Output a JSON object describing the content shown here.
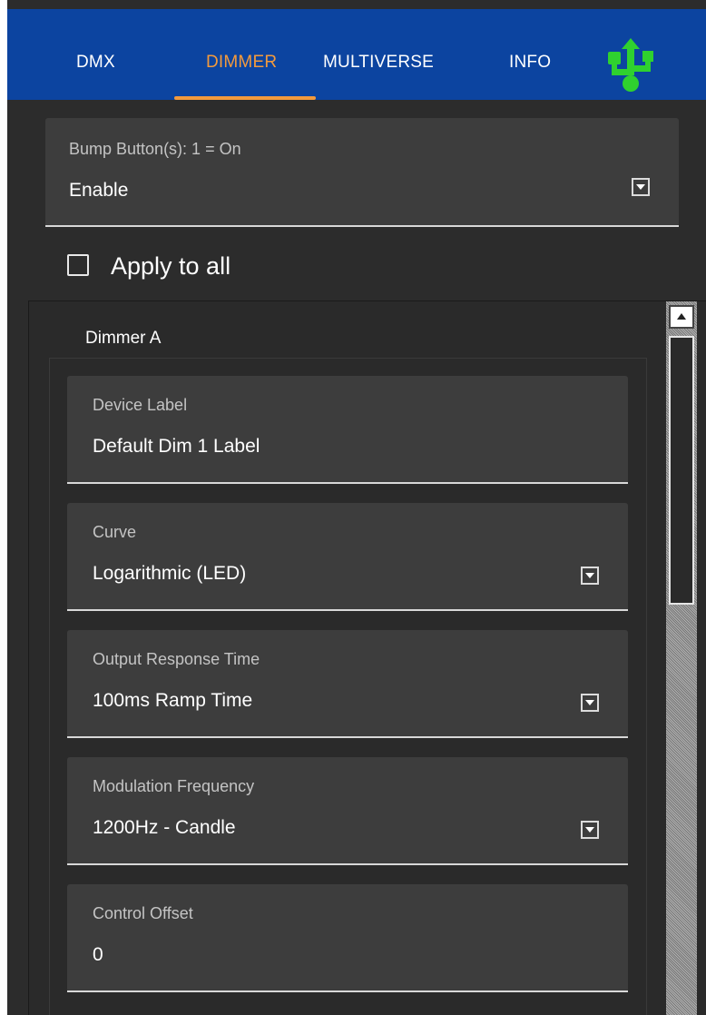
{
  "nav": {
    "tabs": [
      {
        "label": "DMX",
        "active": false
      },
      {
        "label": "DIMMER",
        "active": true
      },
      {
        "label": "MULTIVERSE",
        "active": false
      },
      {
        "label": "INFO",
        "active": false
      }
    ],
    "usb_icon": "usb-icon",
    "bar_color": "#0c44a0",
    "accent_color": "#f39a3d",
    "usb_color": "#2fd12f"
  },
  "bump": {
    "label": "Bump Button(s): 1 = On",
    "value": "Enable",
    "dropdown_icon": "chevron-down-icon"
  },
  "apply_all": {
    "label": "Apply to all",
    "checked": false
  },
  "dimmer_group": {
    "title": "Dimmer A",
    "fields": [
      {
        "label": "Device Label",
        "value": "Default Dim 1 Label",
        "has_dropdown": false
      },
      {
        "label": "Curve",
        "value": "Logarithmic (LED)",
        "has_dropdown": true
      },
      {
        "label": "Output Response Time",
        "value": "100ms Ramp Time",
        "has_dropdown": true
      },
      {
        "label": "Modulation Frequency",
        "value": "1200Hz - Candle",
        "has_dropdown": true
      },
      {
        "label": "Control Offset",
        "value": "0",
        "has_dropdown": false
      }
    ]
  },
  "scrollbar": {
    "up_icon": "arrow-up-icon"
  }
}
